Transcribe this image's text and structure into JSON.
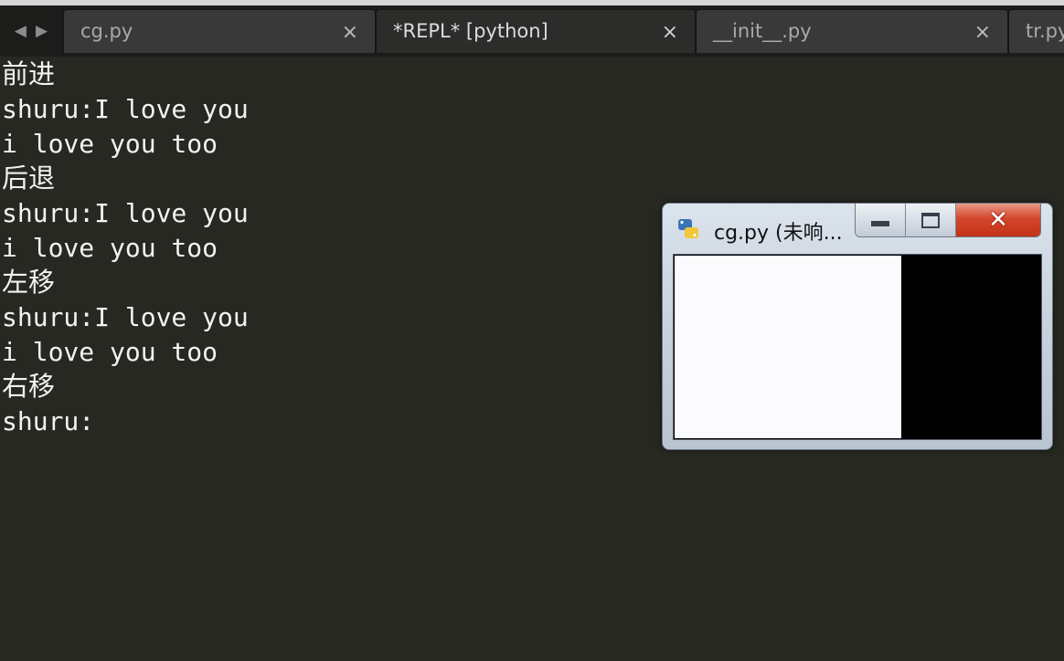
{
  "tabs": [
    {
      "label": "cg.py",
      "close": "×",
      "active": false
    },
    {
      "label": "*REPL* [python]",
      "close": "×",
      "active": true
    },
    {
      "label": "__init__.py",
      "close": "×",
      "active": false
    },
    {
      "label": "tr.py",
      "active": false
    }
  ],
  "nav": {
    "back": "◀",
    "forward": "▶"
  },
  "console": {
    "lines": [
      "前进",
      "shuru:I love you",
      "i love you too",
      "后退",
      "shuru:I love you",
      "i love you too",
      "左移",
      "shuru:I love you",
      "i love you too",
      "右移",
      "shuru:"
    ]
  },
  "popup": {
    "title": "cg.py (未响...",
    "icon": "python-icon",
    "close": "✕"
  },
  "colors": {
    "background": "#272822",
    "text": "#f2f2ee",
    "tabbar": "#1c1c1a",
    "close_button": "#c33317"
  }
}
